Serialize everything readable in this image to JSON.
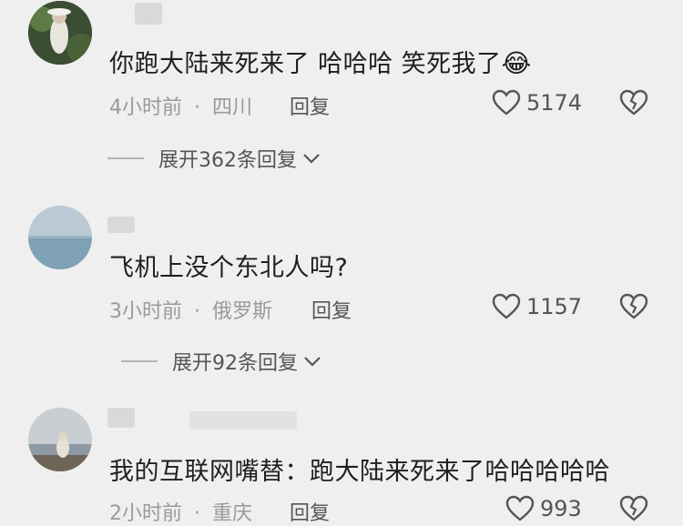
{
  "comments": [
    {
      "text": "你跑大陆来死来了 哈哈哈 笑死我了",
      "emoji": "😂",
      "time": "4小时前",
      "location": "四川",
      "reply_label": "回复",
      "likes": "5174",
      "expand_label": "展开362条回复"
    },
    {
      "text": "飞机上没个东北人吗?",
      "time": "3小时前",
      "location": "俄罗斯",
      "reply_label": "回复",
      "likes": "1157",
      "expand_label": "展开92条回复"
    },
    {
      "text": "我的互联网嘴替：跑大陆来死来了哈哈哈哈哈",
      "time": "2小时前",
      "location": "重庆",
      "reply_label": "回复",
      "likes": "993"
    }
  ],
  "separator": "·",
  "icons": {
    "like": "heart-outline-icon",
    "dislike": "broken-heart-icon",
    "expand": "chevron-down-icon"
  },
  "colors": {
    "background": "#efefef",
    "meta_text": "#9a9a9a",
    "body_text": "#1f1f1f"
  }
}
